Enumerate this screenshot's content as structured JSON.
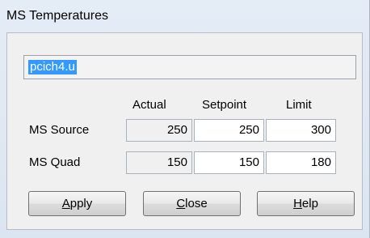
{
  "window": {
    "title": "MS Temperatures"
  },
  "file_field": {
    "value": "pcich4.u"
  },
  "columns": {
    "actual": "Actual",
    "setpoint": "Setpoint",
    "limit": "Limit"
  },
  "rows": [
    {
      "label": "MS Source",
      "actual": "250",
      "setpoint": "250",
      "limit": "300"
    },
    {
      "label": "MS Quad",
      "actual": "150",
      "setpoint": "150",
      "limit": "180"
    }
  ],
  "buttons": {
    "apply": {
      "mnemonic": "A",
      "rest": "pply"
    },
    "close": {
      "mnemonic": "C",
      "rest": "lose"
    },
    "help": {
      "mnemonic": "H",
      "rest": "elp"
    }
  },
  "colors": {
    "selection": "#3399ff",
    "window_frame": "#dbe5f1"
  }
}
